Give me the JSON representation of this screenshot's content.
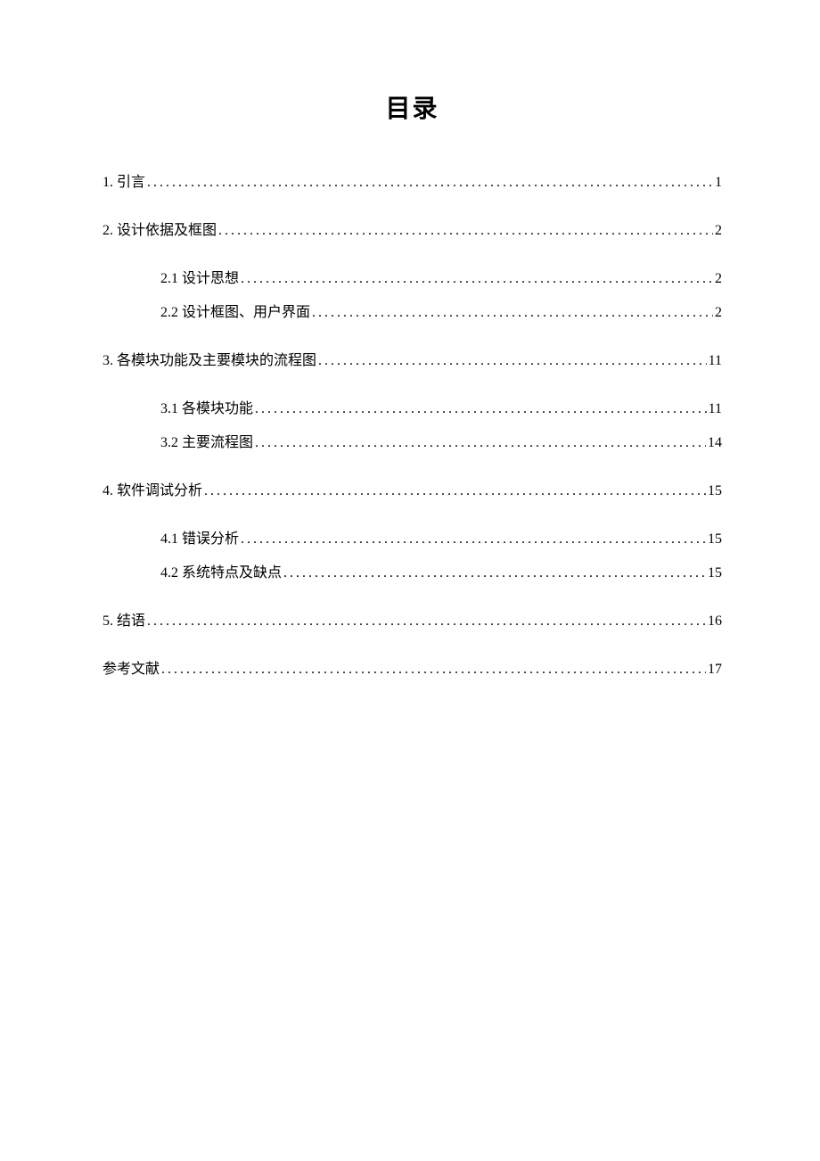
{
  "title": "目录",
  "entries": [
    {
      "level": 1,
      "label": "1. 引言",
      "page": "1"
    },
    {
      "level": 1,
      "label": "2.  设计依据及框图",
      "page": "2"
    },
    {
      "level": 2,
      "label": "2.1 设计思想",
      "page": "2"
    },
    {
      "level": 2,
      "label": "2.2 设计框图、用户界面",
      "page": "2"
    },
    {
      "level": 1,
      "label": "3. 各模块功能及主要模块的流程图",
      "page": "11"
    },
    {
      "level": 2,
      "label": "3.1 各模块功能",
      "page": "11"
    },
    {
      "level": 2,
      "label": "3.2 主要流程图",
      "page": "14"
    },
    {
      "level": 1,
      "label": "4. 软件调试分析",
      "page": "15"
    },
    {
      "level": 2,
      "label": "4.1 错误分析",
      "page": "15"
    },
    {
      "level": 2,
      "label": "4.2 系统特点及缺点",
      "page": "15"
    },
    {
      "level": 1,
      "label": "5. 结语",
      "page": "16"
    },
    {
      "level": 1,
      "label": "参考文献",
      "page": "17"
    }
  ]
}
